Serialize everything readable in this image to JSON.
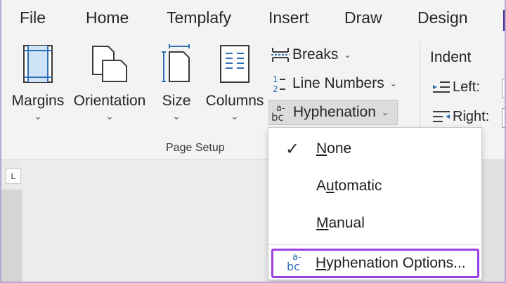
{
  "tabs": [
    {
      "label": "File"
    },
    {
      "label": "Home"
    },
    {
      "label": "Templafy"
    },
    {
      "label": "Insert"
    },
    {
      "label": "Draw"
    },
    {
      "label": "Design"
    }
  ],
  "page_setup": {
    "margins": "Margins",
    "orientation": "Orientation",
    "size": "Size",
    "columns": "Columns",
    "breaks": "Breaks",
    "line_numbers": "Line Numbers",
    "hyphenation": "Hyphenation",
    "group_label": "Page Setup",
    "chevron": "⌄"
  },
  "indent": {
    "title": "Indent",
    "left": "Left:",
    "right": "Right:"
  },
  "hyphenation_menu": {
    "checkmark": "✓",
    "items": [
      {
        "pre": "",
        "mnemonic": "N",
        "post": "one",
        "checked": true
      },
      {
        "pre": "A",
        "mnemonic": "u",
        "post": "tomatic",
        "checked": false
      },
      {
        "pre": "",
        "mnemonic": "M",
        "post": "anual",
        "checked": false
      }
    ],
    "options": {
      "pre": "",
      "mnemonic": "H",
      "post": "yphenation Options..."
    }
  },
  "icons": {
    "breaks": "breaks-icon",
    "line_numbers": "line-numbers-icon",
    "hyphenation": "hyphenation-icon"
  },
  "ruler_corner": "L",
  "colors": {
    "accent_highlight": "#9a3fe0",
    "icon_blue": "#2f6fb5",
    "ribbon_bg": "#f3f3f3"
  }
}
